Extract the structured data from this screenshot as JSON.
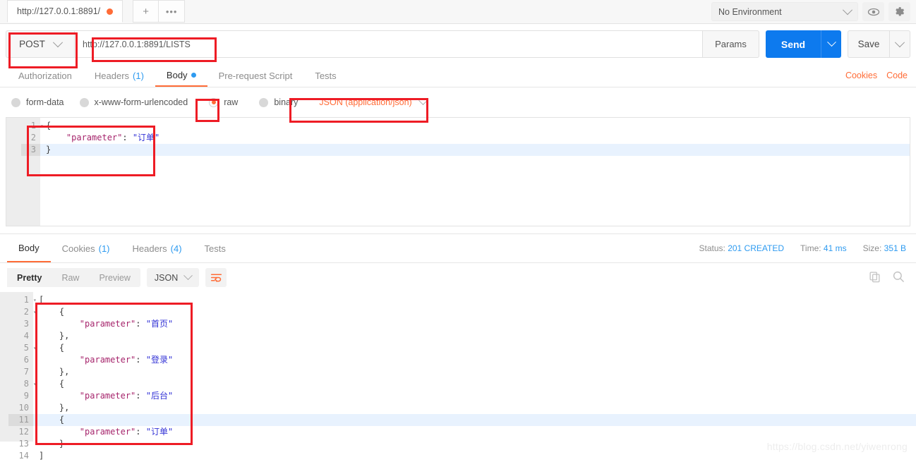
{
  "tabbar": {
    "request_tab_label": "http://127.0.0.1:8891/",
    "unsaved_dot": "unsaved-dot",
    "new_tab_label": "+",
    "more_label": "•••",
    "environment_label": "No Environment",
    "eye_icon": "eye-icon",
    "gear_icon": "gear-icon"
  },
  "request": {
    "method": "POST",
    "url": "http://127.0.0.1:8891/LISTS",
    "params_label": "Params",
    "send_label": "Send",
    "save_label": "Save",
    "tabs": [
      {
        "label": "Authorization",
        "badge": "",
        "active": false
      },
      {
        "label": "Headers",
        "badge": "(1)",
        "active": false
      },
      {
        "label": "Body",
        "badge": "",
        "active": true
      },
      {
        "label": "Pre-request Script",
        "badge": "",
        "active": false
      },
      {
        "label": "Tests",
        "badge": "",
        "active": false
      }
    ],
    "cookies_link": "Cookies",
    "code_link": "Code",
    "body_types": [
      {
        "label": "form-data",
        "checked": false
      },
      {
        "label": "x-www-form-urlencoded",
        "checked": false
      },
      {
        "label": "raw",
        "checked": true
      },
      {
        "label": "binary",
        "checked": false
      }
    ],
    "content_type": "JSON (application/json)",
    "body_lines": [
      {
        "n": "1",
        "fold": "▾",
        "text": "{",
        "hl": false
      },
      {
        "n": "2",
        "fold": "",
        "text": "    \"parameter\": \"订单\"",
        "hl": false
      },
      {
        "n": "3",
        "fold": "",
        "text": "}",
        "hl": true
      }
    ]
  },
  "response": {
    "tabs": [
      {
        "label": "Body",
        "badge": "",
        "active": true
      },
      {
        "label": "Cookies",
        "badge": "(1)",
        "active": false
      },
      {
        "label": "Headers",
        "badge": "(4)",
        "active": false
      },
      {
        "label": "Tests",
        "badge": "",
        "active": false
      }
    ],
    "status_label": "Status:",
    "status_value": "201 CREATED",
    "time_label": "Time:",
    "time_value": "41 ms",
    "size_label": "Size:",
    "size_value": "351 B",
    "view_modes": [
      {
        "label": "Pretty",
        "active": true
      },
      {
        "label": "Raw",
        "active": false
      },
      {
        "label": "Preview",
        "active": false
      }
    ],
    "format": "JSON",
    "wrap_icon": "word-wrap-icon",
    "copy_icon": "copy-icon",
    "search_icon": "search-icon",
    "body_lines": [
      {
        "n": "1",
        "fold": "▾",
        "text": "[",
        "hl": false
      },
      {
        "n": "2",
        "fold": "▾",
        "text": "    {",
        "hl": false
      },
      {
        "n": "3",
        "fold": "",
        "text": "        \"parameter\": \"首页\"",
        "hl": false
      },
      {
        "n": "4",
        "fold": "",
        "text": "    },",
        "hl": false
      },
      {
        "n": "5",
        "fold": "▾",
        "text": "    {",
        "hl": false
      },
      {
        "n": "6",
        "fold": "",
        "text": "        \"parameter\": \"登录\"",
        "hl": false
      },
      {
        "n": "7",
        "fold": "",
        "text": "    },",
        "hl": false
      },
      {
        "n": "8",
        "fold": "▾",
        "text": "    {",
        "hl": false
      },
      {
        "n": "9",
        "fold": "",
        "text": "        \"parameter\": \"后台\"",
        "hl": false
      },
      {
        "n": "10",
        "fold": "",
        "text": "    },",
        "hl": false
      },
      {
        "n": "11",
        "fold": "▾",
        "text": "    {",
        "hl": true
      },
      {
        "n": "12",
        "fold": "",
        "text": "        \"parameter\": \"订单\"",
        "hl": false
      },
      {
        "n": "13",
        "fold": "",
        "text": "    }",
        "hl": false
      },
      {
        "n": "14",
        "fold": "",
        "text": "]",
        "hl": false
      }
    ]
  },
  "watermark": "https://blog.csdn.net/yiwenrong",
  "colors": {
    "accent_orange": "#ff6c37",
    "send_blue": "#0d7aee",
    "annotation_red": "#ee1c25",
    "status_blue": "#2e9bf0"
  }
}
